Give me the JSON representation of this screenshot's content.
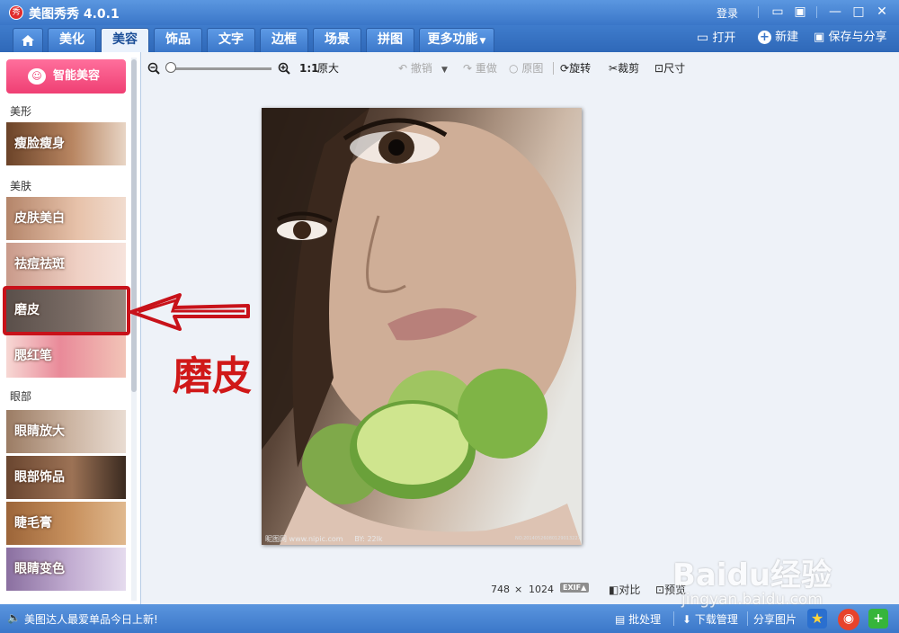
{
  "app": {
    "title": "美图秀秀 4.0.1",
    "logo_char": "秀",
    "login": "登录"
  },
  "tabs": [
    {
      "label": ""
    },
    {
      "label": "美化"
    },
    {
      "label": "美容"
    },
    {
      "label": "饰品"
    },
    {
      "label": "文字"
    },
    {
      "label": "边框"
    },
    {
      "label": "场景"
    },
    {
      "label": "拼图"
    },
    {
      "label": "更多功能"
    }
  ],
  "header_actions": {
    "open": "打开",
    "new": "新建",
    "save_share": "保存与分享"
  },
  "sidebar": {
    "smart_button": "智能美容",
    "categories": {
      "shape": "美形",
      "skin": "美肤",
      "eyes": "眼部"
    },
    "items": [
      {
        "label": "瘦脸瘦身",
        "color": "#9c6a4a"
      },
      {
        "label": "皮肤美白",
        "color": "#d8a78a"
      },
      {
        "label": "祛痘祛斑",
        "color": "#e2bdb0"
      },
      {
        "label": "磨皮",
        "color": "#6f625b"
      },
      {
        "label": "腮红笔",
        "color": "#e99aa6"
      },
      {
        "label": "眼睛放大",
        "color": "#b49a86"
      },
      {
        "label": "眼部饰品",
        "color": "#7c5842"
      },
      {
        "label": "睫毛膏",
        "color": "#b0784e"
      },
      {
        "label": "眼睛变色",
        "color": "#a88bb9"
      }
    ]
  },
  "toolbar": {
    "ratio": "1:1",
    "original_size": "原大",
    "undo": "撤销",
    "redo": "重做",
    "original": "原图",
    "rotate": "旋转",
    "crop": "裁剪",
    "size": "尺寸"
  },
  "photo": {
    "watermark_left": "昵图网 www.nipic.com",
    "watermark_right": "BY: 22lk",
    "watermark_id": "NO.20140526080129013227"
  },
  "annotation": {
    "label": "磨皮",
    "color": "#d01818"
  },
  "image_info": {
    "width": "748",
    "times": "×",
    "height": "1024",
    "exif": "EXIF▲",
    "compare": "对比",
    "preview": "预览"
  },
  "status": {
    "marquee": "美图达人最爱单品今日上新!",
    "batch": "批处理",
    "downloads": "下载管理",
    "share": "分享图片"
  },
  "external_watermark": {
    "brand": "Baidu经验",
    "url": "jingyan.baidu.com"
  },
  "colors": {
    "accent": "#3a76c8",
    "pink": "#ef3f73",
    "annotation_red": "#d01818"
  }
}
